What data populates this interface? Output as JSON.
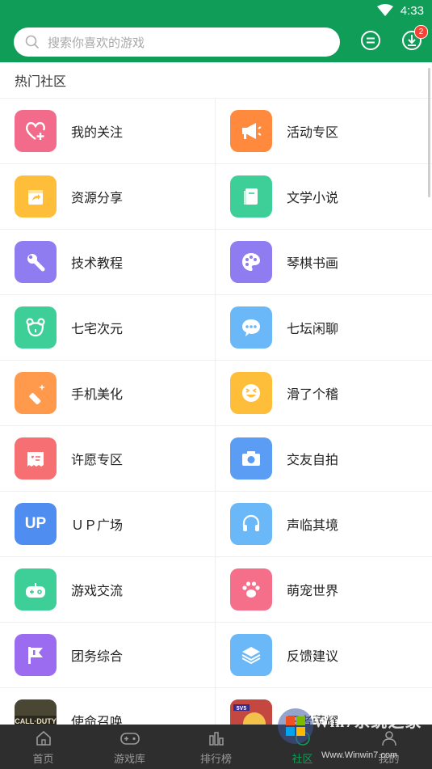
{
  "status_bar": {
    "time": "4:33",
    "wifi_icon": "wifi-icon"
  },
  "header": {
    "search_placeholder": "搜索你喜欢的游戏",
    "download_badge": "2"
  },
  "section_title": "热门社区",
  "communities": [
    {
      "label": "我的关注",
      "icon": "heart-plus-icon",
      "color": "#f26b8a"
    },
    {
      "label": "活动专区",
      "icon": "megaphone-icon",
      "color": "#ff8a3d"
    },
    {
      "label": "资源分享",
      "icon": "share-box-icon",
      "color": "#ffbe3a"
    },
    {
      "label": "文学小说",
      "icon": "book-icon",
      "color": "#3ecf98"
    },
    {
      "label": "技术教程",
      "icon": "wrench-icon",
      "color": "#8e7cf0"
    },
    {
      "label": "琴棋书画",
      "icon": "palette-icon",
      "color": "#8e7cf0"
    },
    {
      "label": "七宅次元",
      "icon": "bear-icon",
      "color": "#3ecf98"
    },
    {
      "label": "七坛闲聊",
      "icon": "chat-bubble-icon",
      "color": "#6ab8f7"
    },
    {
      "label": "手机美化",
      "icon": "brush-icon",
      "color": "#ff9a4d"
    },
    {
      "label": "滑了个稽",
      "icon": "laugh-face-icon",
      "color": "#ffbe3a"
    },
    {
      "label": "许愿专区",
      "icon": "ticket-icon",
      "color": "#f56f73"
    },
    {
      "label": "交友自拍",
      "icon": "camera-icon",
      "color": "#5b9cf5"
    },
    {
      "label": "ＵＰ广场",
      "icon": "up-icon",
      "color": "#4f8ef0"
    },
    {
      "label": "声临其境",
      "icon": "headphones-icon",
      "color": "#6ab8f7"
    },
    {
      "label": "游戏交流",
      "icon": "gamepad-icon",
      "color": "#3ecf98"
    },
    {
      "label": "萌宠世界",
      "icon": "paw-icon",
      "color": "#f56f8a"
    },
    {
      "label": "团务综合",
      "icon": "flag-icon",
      "color": "#9b6cf0"
    },
    {
      "label": "反馈建议",
      "icon": "layers-icon",
      "color": "#6ab8f7"
    },
    {
      "label": "使命召唤",
      "icon": "game-cover-icon",
      "color": "#3a3a2a"
    },
    {
      "label": "王者荣耀",
      "icon": "game-cover-icon",
      "color": "#b0403a"
    }
  ],
  "up_text": "UP",
  "tabs": [
    {
      "label": "首页",
      "icon": "home-icon"
    },
    {
      "label": "游戏库",
      "icon": "gamepad-icon"
    },
    {
      "label": "排行榜",
      "icon": "ranking-icon"
    },
    {
      "label": "社区",
      "icon": "community-icon"
    },
    {
      "label": "我的",
      "icon": "user-icon"
    }
  ],
  "watermark": {
    "text": "Win7系统之家",
    "url": "Www.Winwin7.com"
  }
}
